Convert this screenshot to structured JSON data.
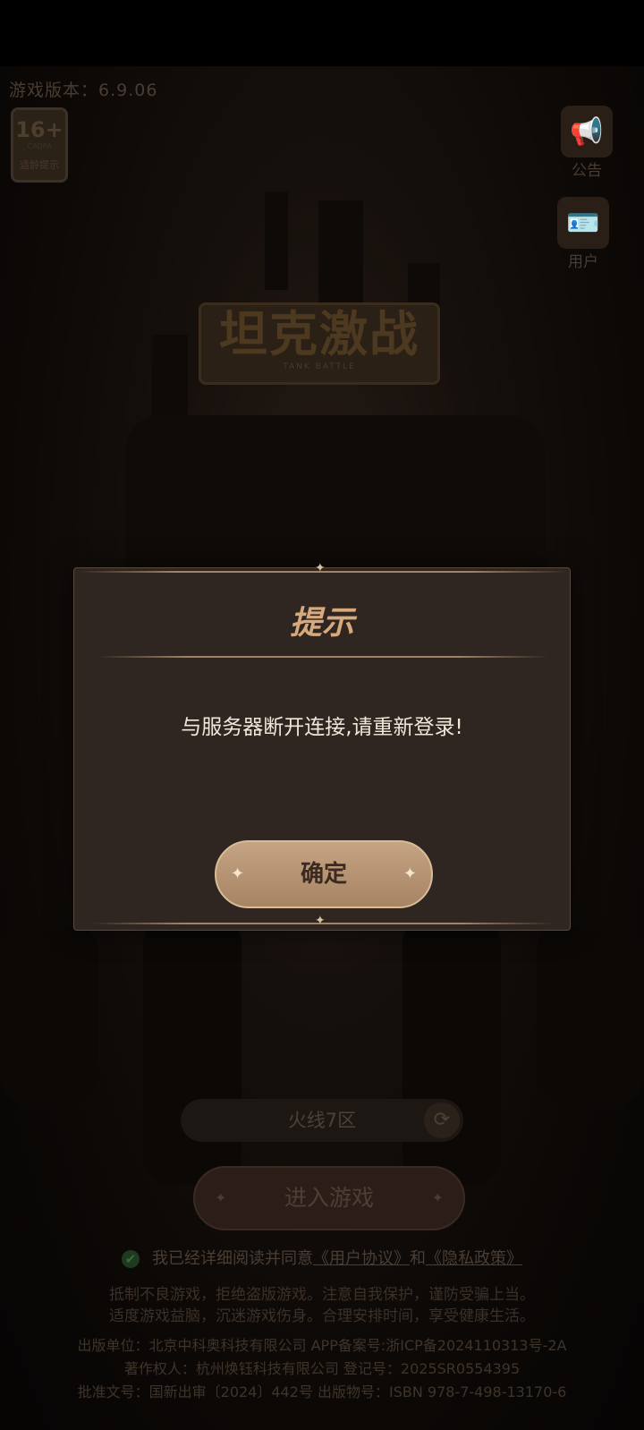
{
  "header": {
    "version_label": "游戏版本：6.9.06"
  },
  "age_badge": {
    "rating": "16+",
    "cadpa": "CADPA",
    "tip": "适龄提示"
  },
  "side_buttons": {
    "announcement": "公告",
    "user": "用户"
  },
  "logo": {
    "title": "坦克激战",
    "subtitle": "TANK BATTLE"
  },
  "modal": {
    "title": "提示",
    "message": "与服务器断开连接,请重新登录!",
    "confirm_label": "确定"
  },
  "server": {
    "name": "火线7区"
  },
  "enter_button": {
    "label": "进入游戏"
  },
  "agreement": {
    "prefix": "我已经详细阅读并同意",
    "user_agreement": "《用户协议》",
    "and": "和",
    "privacy_policy": "《隐私政策》"
  },
  "health_notice": {
    "line1": "抵制不良游戏，拒绝盗版游戏。注意自我保护，谨防受骗上当。",
    "line2": "适度游戏益脑，沉迷游戏伤身。合理安排时间，享受健康生活。"
  },
  "legal": {
    "line1": "出版单位：北京中科奥科技有限公司   APP备案号:浙ICP备2024110313号-2A",
    "line2": "著作权人：杭州焕钰科技有限公司   登记号：2025SR0554395",
    "line3": "批准文号：国新出审〔2024〕442号   出版物号：ISBN 978-7-498-13170-6"
  }
}
